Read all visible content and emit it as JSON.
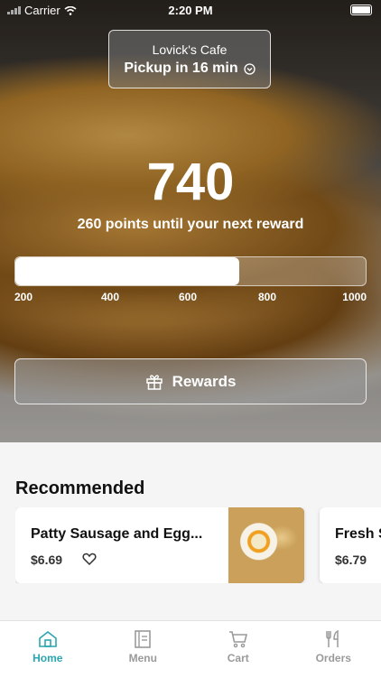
{
  "status_bar": {
    "carrier": "Carrier",
    "time": "2:20 PM"
  },
  "pickup": {
    "store_name": "Lovick's Cafe",
    "time_text": "Pickup in 16 min"
  },
  "rewards": {
    "points": "740",
    "subtitle": "260 points until your next reward",
    "progress_fraction": 0.64,
    "ticks": [
      "200",
      "400",
      "600",
      "800",
      "1000"
    ],
    "button_label": "Rewards"
  },
  "recommended": {
    "title": "Recommended",
    "items": [
      {
        "name": "Patty Sausage and Egg...",
        "price": "$6.69"
      },
      {
        "name": "Fresh S",
        "price": "$6.79"
      }
    ]
  },
  "tabbar": {
    "active_color": "#2aa6b0",
    "tabs": [
      {
        "label": "Home",
        "icon": "home-icon"
      },
      {
        "label": "Menu",
        "icon": "menu-icon"
      },
      {
        "label": "Cart",
        "icon": "cart-icon"
      },
      {
        "label": "Orders",
        "icon": "fork-knife-icon"
      }
    ]
  }
}
